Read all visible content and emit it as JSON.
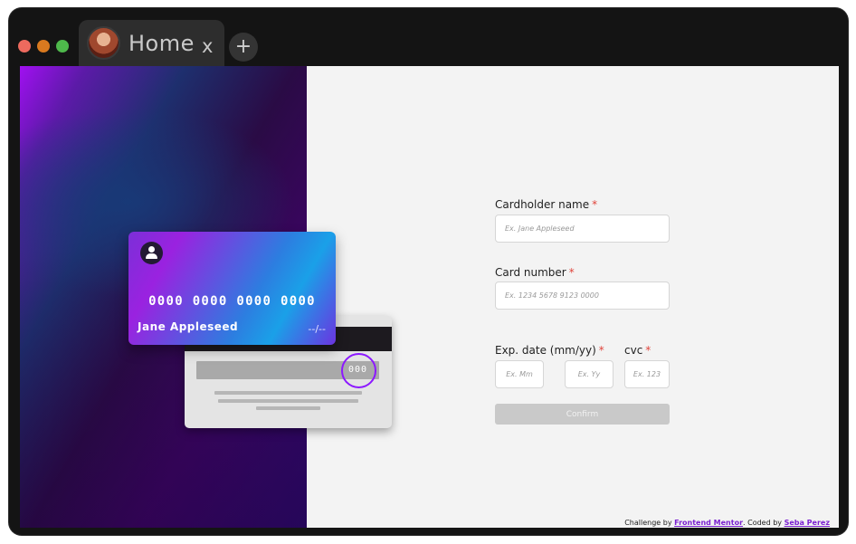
{
  "window": {
    "tab_title": "Home",
    "tab_close": "x",
    "new_tab": "+"
  },
  "card_front": {
    "number": "0000 0000 0000 0000",
    "name": "Jane Appleseed",
    "expiry": "--/--"
  },
  "card_back": {
    "cvc": "000"
  },
  "form": {
    "cardholder_label": "Cardholder name",
    "cardholder_placeholder": "Ex. Jane Appleseed",
    "number_label": "Card number",
    "number_placeholder": "Ex. 1234 5678 9123 0000",
    "exp_label": "Exp. date (mm/yy)",
    "month_placeholder": "Ex. Mm",
    "year_placeholder": "Ex. Yy",
    "cvc_label": "cvc",
    "cvc_placeholder": "Ex. 123",
    "required_mark": "*",
    "confirm_label": "Confirm"
  },
  "footer": {
    "prefix": "Challenge by ",
    "link1": "Frontend Mentor",
    "middle": ". Coded by ",
    "link2": "Seba Perez"
  },
  "colors": {
    "accent": "#8c18ff",
    "required": "#e0443b",
    "confirm_disabled": "#c9c9c9"
  }
}
